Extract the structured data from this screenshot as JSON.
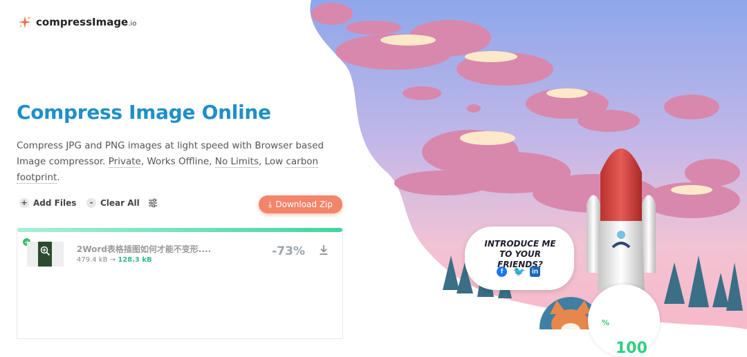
{
  "brand": {
    "name": "compressImage",
    "tld": ".io"
  },
  "hero": {
    "title": "Compress Image Online",
    "subtitle_prefix": "Compress JPG and PNG images at light speed with Browser based Image compressor. ",
    "feature_1": "Private",
    "sep_1": ", ",
    "feature_2": "Works Offline",
    "sep_2": ", ",
    "feature_3": "No Limits",
    "sep_3": ", Low ",
    "feature_4": "carbon footprint",
    "end": "."
  },
  "toolbar": {
    "add_icon": "+",
    "add_label": "Add Files",
    "clear_icon": "-",
    "clear_label": "Clear All",
    "download_icon": "⤓",
    "download_label": "Download Zip"
  },
  "files": [
    {
      "name": "2Word表格插图如何才能不变形....",
      "original_size": "479.4 kB",
      "arrow": "→",
      "compressed_size": "128.3 kB",
      "reduction": "-73%",
      "progress": 1.0
    }
  ],
  "share": {
    "text": "INTRODUCE ME TO YOUR FRIENDS?",
    "facebook": "f",
    "twitter": "🐦",
    "linkedin": "in"
  },
  "badge": {
    "value": "100",
    "unit": "%"
  },
  "colors": {
    "accent": "#1f8fc7",
    "download_button": "#f2856a",
    "success": "#2fb98a",
    "progress_start": "#a9f0d7",
    "progress_end": "#3fd6a0"
  }
}
